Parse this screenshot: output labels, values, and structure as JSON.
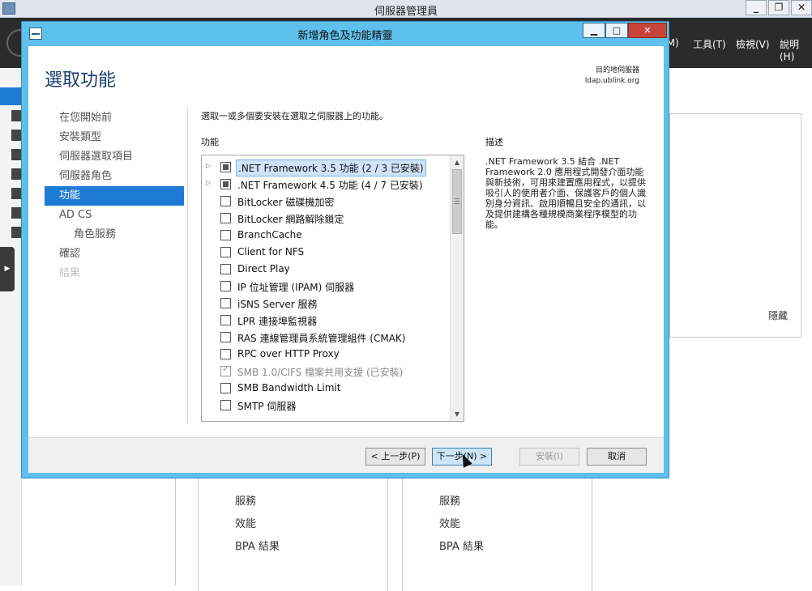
{
  "server_manager": {
    "title": "伺服器管理員",
    "window_controls": [
      "_",
      "❐",
      "✕"
    ],
    "menu": [
      "(M)",
      "工具(T)",
      "檢視(V)",
      "說明(H)"
    ],
    "hide_label": "隱藏",
    "tiles": [
      {
        "items": [
          "服務",
          "效能",
          "BPA 結果"
        ]
      },
      {
        "items": [
          "服務",
          "效能",
          "BPA 結果"
        ]
      }
    ]
  },
  "wizard": {
    "title": "新增角色及功能精靈",
    "window_controls": [
      "▁",
      "□",
      "✕"
    ],
    "page_title": "選取功能",
    "destination": {
      "label": "目的地伺服器",
      "server": "ldap.ublink.org"
    },
    "steps": [
      {
        "label": "在您開始前",
        "state": "normal"
      },
      {
        "label": "安裝類型",
        "state": "normal"
      },
      {
        "label": "伺服器選取項目",
        "state": "normal"
      },
      {
        "label": "伺服器角色",
        "state": "normal"
      },
      {
        "label": "功能",
        "state": "active"
      },
      {
        "label": "AD CS",
        "state": "normal"
      },
      {
        "label": "角色服務",
        "state": "sub"
      },
      {
        "label": "確認",
        "state": "normal"
      },
      {
        "label": "結果",
        "state": "disabled"
      }
    ],
    "instruction": "選取一或多個要安裝在選取之伺服器上的功能。",
    "features_header": "功能",
    "description_header": "描述",
    "features": [
      {
        "label": ".NET Framework 3.5 功能 (2 / 3 已安裝)",
        "state": "partial",
        "expandable": true,
        "selected": true
      },
      {
        "label": ".NET Framework 4.5 功能 (4 / 7 已安裝)",
        "state": "partial",
        "expandable": true,
        "selected": false
      },
      {
        "label": "BitLocker 磁碟機加密",
        "state": "unchecked"
      },
      {
        "label": "BitLocker 網路解除鎖定",
        "state": "unchecked"
      },
      {
        "label": "BranchCache",
        "state": "unchecked"
      },
      {
        "label": "Client for NFS",
        "state": "unchecked"
      },
      {
        "label": "Direct Play",
        "state": "unchecked"
      },
      {
        "label": "IP 位址管理 (IPAM) 伺服器",
        "state": "unchecked"
      },
      {
        "label": "iSNS Server 服務",
        "state": "unchecked"
      },
      {
        "label": "LPR 連接埠監視器",
        "state": "unchecked"
      },
      {
        "label": "RAS 連線管理員系統管理組件 (CMAK)",
        "state": "unchecked"
      },
      {
        "label": "RPC over HTTP Proxy",
        "state": "unchecked"
      },
      {
        "label": "SMB 1.0/CIFS 檔案共用支援 (已安裝)",
        "state": "installed"
      },
      {
        "label": "SMB Bandwidth Limit",
        "state": "unchecked"
      },
      {
        "label": "SMTP  伺服器",
        "state": "unchecked"
      }
    ],
    "description": ".NET Framework 3.5 結合 .NET Framework 2.0 應用程式開發介面功能與新技術，可用來建置應用程式，以提供吸引人的使用者介面、保護客戶的個人識別身分資訊、啟用順暢且安全的通訊，以及提供建構各種規模商業程序模型的功能。",
    "buttons": {
      "previous": "< 上一步(P)",
      "next": "下一步(N) >",
      "install": "安裝(I)",
      "cancel": "取消"
    }
  }
}
